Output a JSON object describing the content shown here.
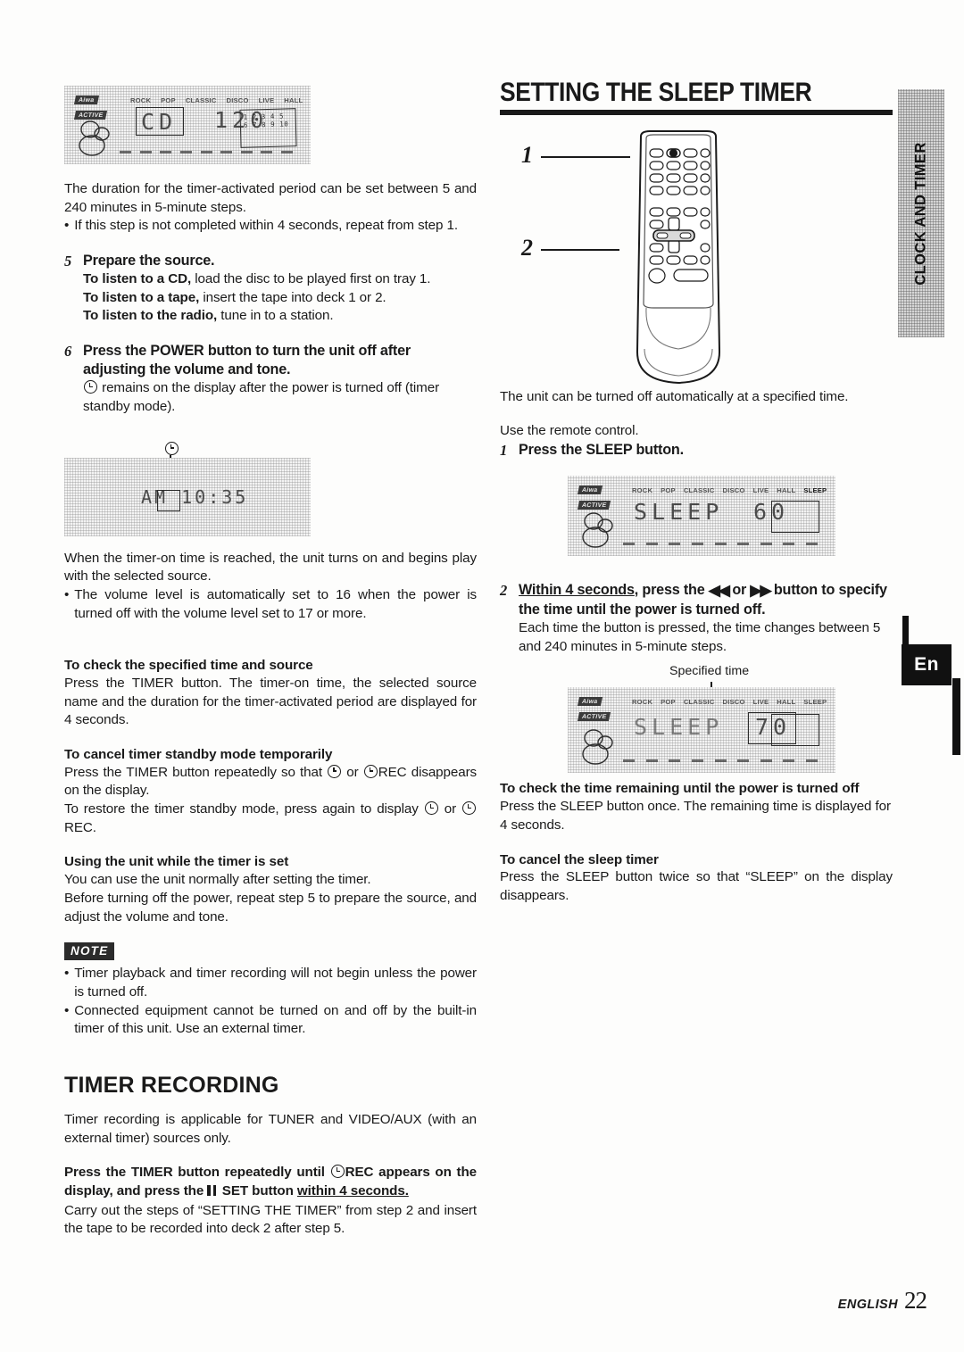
{
  "page": {
    "side_tab_label": "CLOCK AND TIMER",
    "lang_badge": "En",
    "footer_language": "ENGLISH",
    "footer_page": "22"
  },
  "left_column": {
    "display_1": {
      "brand_top": "Aiwa",
      "brand_bottom": "ACTIVE",
      "indicators": [
        "ROCK",
        "POP",
        "CLASSIC",
        "DISCO",
        "LIVE",
        "HALL"
      ],
      "source_text": "CD",
      "value_text": "120",
      "track_numbers_row1": "1 2 3 4 5",
      "track_numbers_row2": "6 7 8 9 10"
    },
    "intro": "The duration for the timer-activated period can be set between 5 and 240 minutes in 5-minute steps.",
    "intro_bullet": "If this step is not completed within 4 seconds, repeat from step 1.",
    "step5": {
      "number": "5",
      "title": "Prepare the source.",
      "line_cd_lead": "To listen to a CD,",
      "line_cd_rest": " load the disc to be played first on tray 1.",
      "line_tape_lead": "To listen to a tape,",
      "line_tape_rest": " insert the tape into deck 1 or 2.",
      "line_radio_lead": "To listen to the radio,",
      "line_radio_rest": " tune in to a station."
    },
    "step6": {
      "number": "6",
      "title": "Press the POWER button to turn the unit off after adjusting the volume and tone.",
      "body_after_icon": " remains on the display after the power is turned off (timer standby mode)."
    },
    "display_2": {
      "callout_icon": "clock-icon",
      "time_text": "AM 10:35"
    },
    "after_display": "When the timer-on time is reached, the unit turns on and begins play with the selected source.",
    "after_display_bullet": "The volume level is automatically set to 16 when the power is turned off with the volume level set to 17 or more.",
    "check_time": {
      "heading": "To check the specified time and source",
      "body": "Press the TIMER button. The timer-on time, the selected source name and the duration for the timer-activated period are displayed for 4 seconds."
    },
    "cancel_standby": {
      "heading": "To cancel timer standby mode temporarily",
      "body_a": "Press the TIMER button repeatedly so that ",
      "body_b": " or ",
      "body_c": "REC disappears on the display.",
      "body_d": "To restore the timer standby mode, press again to display ",
      "body_e": " or ",
      "body_f": " REC."
    },
    "using_unit": {
      "heading": "Using the unit while the timer is set",
      "body_1": "You can use the unit normally after setting the timer.",
      "body_2": "Before turning off the power, repeat step 5 to prepare the source, and adjust the volume and tone."
    },
    "note": {
      "badge": "NOTE",
      "bullets": [
        "Timer playback and timer recording will not begin unless the power is turned off.",
        "Connected equipment cannot be turned on and off by the built-in timer of this unit.  Use an external timer."
      ]
    },
    "timer_recording": {
      "heading": "TIMER RECORDING",
      "intro": "Timer recording is applicable for TUNER and VIDEO/AUX (with an external timer) sources only.",
      "bold_a": "Press the TIMER button repeatedly until ",
      "bold_b": "REC appears on the display, and press the ",
      "bold_c": " SET button ",
      "bold_d": "within 4 seconds.",
      "body": "Carry out the steps of “SETTING THE TIMER” from step 2 and insert the tape to be recorded into deck 2 after step 5."
    }
  },
  "right_column": {
    "title": "SETTING THE SLEEP TIMER",
    "remote": {
      "callout_1": "1",
      "callout_2": "2"
    },
    "intro": "The unit can be turned off automatically at a specified time.",
    "use_remote": "Use the remote control.",
    "step1": {
      "number": "1",
      "title": "Press the SLEEP button."
    },
    "display_3": {
      "brand_top": "Aiwa",
      "brand_bottom": "ACTIVE",
      "indicators": [
        "ROCK",
        "POP",
        "CLASSIC",
        "DISCO",
        "LIVE",
        "HALL",
        "SLEEP"
      ],
      "text": "SLEEP",
      "value": "60"
    },
    "step2": {
      "number": "2",
      "title_u": "Within 4 seconds",
      "title_a": ", press the ",
      "title_b": " or ",
      "title_c": " button to specify the time until the power is turned off.",
      "body": "Each time the button is pressed, the time changes between 5 and 240 minutes in 5-minute steps."
    },
    "display_4": {
      "callout_label": "Specified time",
      "indicators": [
        "ROCK",
        "POP",
        "CLASSIC",
        "DISCO",
        "LIVE",
        "HALL",
        "SLEEP"
      ],
      "text": "SLEEP",
      "value": "70"
    },
    "check_remaining": {
      "heading": "To check the time remaining until the power is turned off",
      "body": "Press the SLEEP button once.  The remaining time is displayed for 4 seconds."
    },
    "cancel_sleep": {
      "heading": "To cancel the sleep timer",
      "body": "Press the SLEEP button twice so that “SLEEP” on the display disappears."
    }
  }
}
